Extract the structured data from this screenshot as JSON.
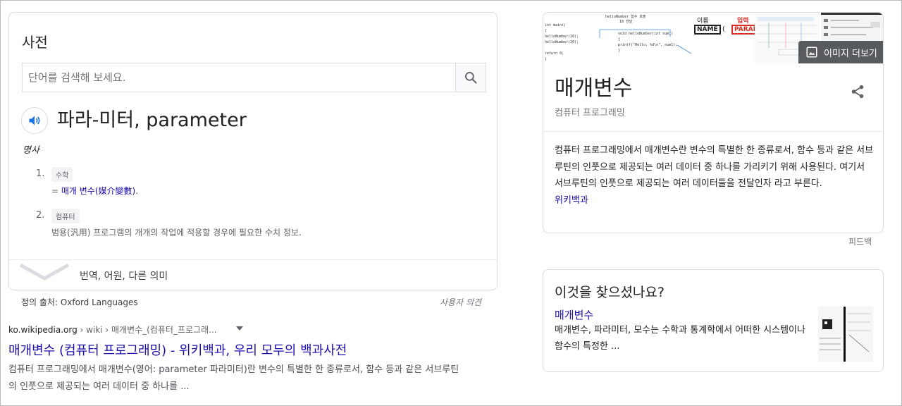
{
  "dictionary": {
    "title": "사전",
    "search_placeholder": "단어를 검색해 보세요.",
    "headword": "파라-미터, parameter",
    "part_of_speech": "명사",
    "senses": [
      {
        "number": "1.",
        "tag": "수학",
        "prefix": "= ",
        "link": "매개 변수(媒介變數)",
        "suffix": "."
      },
      {
        "number": "2.",
        "tag": "컴퓨터",
        "definition": "범용(汎用) 프로그램의 개개의 작업에 적용할 경우에 필요한 수치 정보."
      }
    ],
    "expand_label": "번역, 어원, 다른 의미",
    "source": "정의 출처: Oxford Languages",
    "feedback": "사용자 의견"
  },
  "result": {
    "domain": "ko.wikipedia.org",
    "path": " › wiki › 매개변수_(컴퓨터_프로그래...",
    "title": "매개변수 (컴퓨터 프로그래밍) - 위키백과, 우리 모두의 백과사전",
    "snippet": "컴퓨터 프로그래밍에서 매개변수(영어: parameter 파라미터)란 변수의 특별한 한 종류로서, 함수 등과 같은 서브루틴의 인풋으로 제공되는 여러 데이터 중 하나를 ..."
  },
  "knowledge_panel": {
    "images": {
      "more_label": "이미지 더보기",
      "code_header": "helloNumber 함수 호출",
      "code_sub": "18 전달",
      "code_lines": [
        "int main()",
        "{",
        "  helloNumber(10);",
        "  helloNumber(20);",
        "",
        "  return 0;",
        "}"
      ],
      "code_func": [
        "void helloNumber(int num1)",
        "{",
        "    printf(\"Hello, %d\\n\", num1);",
        "}"
      ],
      "name_label": "이름",
      "name_box": "NAME",
      "param_label": "입력",
      "param_box": "PARAM"
    },
    "title": "매개변수",
    "subtitle": "컴퓨터 프로그래밍",
    "description": "컴퓨터 프로그래밍에서 매개변수란 변수의 특별한 한 종류로서, 함수 등과 같은 서브루틴의 인풋으로 제공되는 여러 데이터 중 하나를 가리키기 위해 사용된다. 여기서 서브루틴의 인풋으로 제공되는 여러 데이터들을 전달인자 라고 부른다.",
    "source_link": "위키백과",
    "feedback": "피드백"
  },
  "did_you_mean": {
    "title": "이것을 찾으셨나요?",
    "link": "매개변수",
    "snippet": "매개변수, 파라미터, 모수는 수학과 통계학에서 어떠한 시스템이나 함수의 특정한 ..."
  },
  "colors": {
    "link": "#1a0dab",
    "speaker": "#1a73e8",
    "param_red": "#d93025"
  }
}
